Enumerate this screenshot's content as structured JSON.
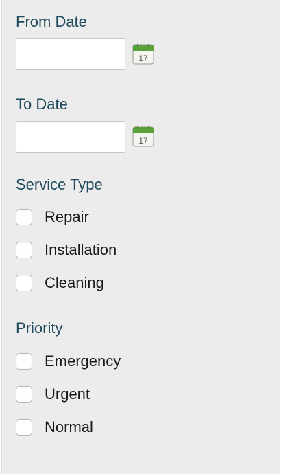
{
  "from_date": {
    "label": "From Date",
    "value": "",
    "calendar_day": "17"
  },
  "to_date": {
    "label": "To Date",
    "value": "",
    "calendar_day": "17"
  },
  "service_type": {
    "label": "Service Type",
    "options": [
      "Repair",
      "Installation",
      "Cleaning"
    ]
  },
  "priority": {
    "label": "Priority",
    "options": [
      "Emergency",
      "Urgent",
      "Normal"
    ]
  },
  "colors": {
    "panel_bg": "#ececec",
    "label": "#1e4a5c",
    "calendar_green": "#5aa13a"
  },
  "icons": {
    "calendar": "calendar-icon"
  }
}
